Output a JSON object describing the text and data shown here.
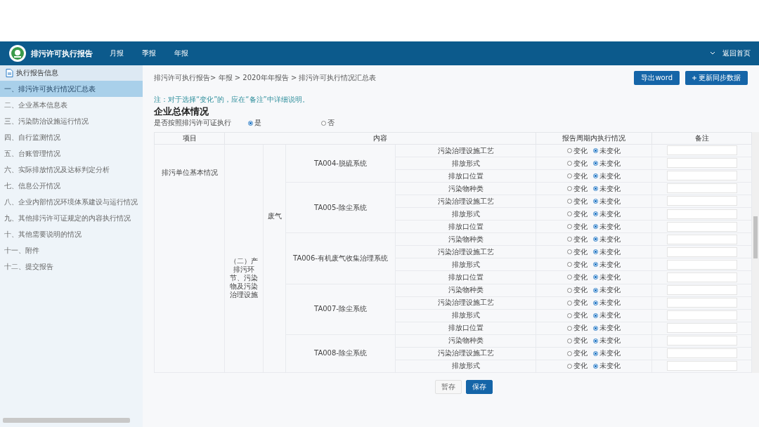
{
  "header": {
    "title": "排污许可执行报告",
    "nav": [
      {
        "label": "月报",
        "selected": false
      },
      {
        "label": "季报",
        "selected": false
      },
      {
        "label": "年报",
        "selected": false
      }
    ],
    "home_link": "返回首页"
  },
  "sidebar": {
    "heading": "执行报告信息",
    "items": [
      {
        "label": "一、排污许可执行情况汇总表",
        "selected": true
      },
      {
        "label": "二、企业基本信息表",
        "selected": false
      },
      {
        "label": "三、污染防治设施运行情况",
        "selected": false
      },
      {
        "label": "四、自行监测情况",
        "selected": false
      },
      {
        "label": "五、台账管理情况",
        "selected": false
      },
      {
        "label": "六、实际排放情况及达标判定分析",
        "selected": false
      },
      {
        "label": "七、信息公开情况",
        "selected": false
      },
      {
        "label": "八、企业内部情况环境体系建设与运行情况",
        "selected": false
      },
      {
        "label": "九、其他排污许可证规定的内容执行情况",
        "selected": false
      },
      {
        "label": "十、其他需要说明的情况",
        "selected": false
      },
      {
        "label": "十一、附件",
        "selected": false
      },
      {
        "label": "十二、提交报告",
        "selected": false
      }
    ]
  },
  "breadcrumb": "排污许可执行报告> 年报 > 2020年年报告 > 排污许可执行情况汇总表",
  "actions": [
    "导出word",
    "更新同步数据"
  ],
  "note": "注：对于选择“变化”的，应在“备注”中详细说明。",
  "section_title": "企业总体情况",
  "question": {
    "label": "是否按照排污许可证执行",
    "options": [
      {
        "label": "是",
        "selected": true
      },
      {
        "label": "否",
        "selected": false
      }
    ]
  },
  "table": {
    "columns": [
      "项目",
      "内容",
      "报告周期内执行情况",
      "备注"
    ],
    "category": "排污单位基本情况",
    "subcategory": "（二）产排污环节、污染物及污染治理设施",
    "medium": "废气",
    "facilities": [
      {
        "name": "TA004-脱硫系统",
        "rows": [
          {
            "item": "污染治理设施工艺",
            "options": [
              {
                "label": "变化",
                "selected": false
              },
              {
                "label": "未变化",
                "selected": true
              }
            ]
          },
          {
            "item": "排放形式",
            "options": [
              {
                "label": "变化",
                "selected": false
              },
              {
                "label": "未变化",
                "selected": true
              }
            ]
          },
          {
            "item": "排放口位置",
            "options": [
              {
                "label": "变化",
                "selected": false
              },
              {
                "label": "未变化",
                "selected": true
              }
            ]
          }
        ]
      },
      {
        "name": "TA005-除尘系统",
        "rows": [
          {
            "item": "污染物种类",
            "options": [
              {
                "label": "变化",
                "selected": false
              },
              {
                "label": "未变化",
                "selected": true
              }
            ]
          },
          {
            "item": "污染治理设施工艺",
            "options": [
              {
                "label": "变化",
                "selected": false
              },
              {
                "label": "未变化",
                "selected": true
              }
            ]
          },
          {
            "item": "排放形式",
            "options": [
              {
                "label": "变化",
                "selected": false
              },
              {
                "label": "未变化",
                "selected": true
              }
            ]
          },
          {
            "item": "排放口位置",
            "options": [
              {
                "label": "变化",
                "selected": false
              },
              {
                "label": "未变化",
                "selected": true
              }
            ]
          }
        ]
      },
      {
        "name": "TA006-有机废气收集治理系统",
        "rows": [
          {
            "item": "污染物种类",
            "options": [
              {
                "label": "变化",
                "selected": false
              },
              {
                "label": "未变化",
                "selected": true
              }
            ]
          },
          {
            "item": "污染治理设施工艺",
            "options": [
              {
                "label": "变化",
                "selected": false
              },
              {
                "label": "未变化",
                "selected": true
              }
            ]
          },
          {
            "item": "排放形式",
            "options": [
              {
                "label": "变化",
                "selected": false
              },
              {
                "label": "未变化",
                "selected": true
              }
            ]
          },
          {
            "item": "排放口位置",
            "options": [
              {
                "label": "变化",
                "selected": false
              },
              {
                "label": "未变化",
                "selected": true
              }
            ]
          }
        ]
      },
      {
        "name": "TA007-除尘系统",
        "rows": [
          {
            "item": "污染物种类",
            "options": [
              {
                "label": "变化",
                "selected": false
              },
              {
                "label": "未变化",
                "selected": true
              }
            ]
          },
          {
            "item": "污染治理设施工艺",
            "options": [
              {
                "label": "变化",
                "selected": false
              },
              {
                "label": "未变化",
                "selected": true
              }
            ]
          },
          {
            "item": "排放形式",
            "options": [
              {
                "label": "变化",
                "selected": false
              },
              {
                "label": "未变化",
                "selected": true
              }
            ]
          },
          {
            "item": "排放口位置",
            "options": [
              {
                "label": "变化",
                "selected": false
              },
              {
                "label": "未变化",
                "selected": true
              }
            ]
          }
        ]
      },
      {
        "name": "TA008-除尘系统",
        "rows": [
          {
            "item": "污染物种类",
            "options": [
              {
                "label": "变化",
                "selected": false
              },
              {
                "label": "未变化",
                "selected": true
              }
            ]
          },
          {
            "item": "污染治理设施工艺",
            "options": [
              {
                "label": "变化",
                "selected": false
              },
              {
                "label": "未变化",
                "selected": true
              }
            ]
          },
          {
            "item": "排放形式",
            "options": [
              {
                "label": "变化",
                "selected": false
              },
              {
                "label": "未变化",
                "selected": true
              }
            ]
          }
        ]
      }
    ]
  },
  "footer_buttons": [
    {
      "label": "暂存",
      "kind": "secondary"
    },
    {
      "label": "保存",
      "kind": "primary"
    }
  ]
}
